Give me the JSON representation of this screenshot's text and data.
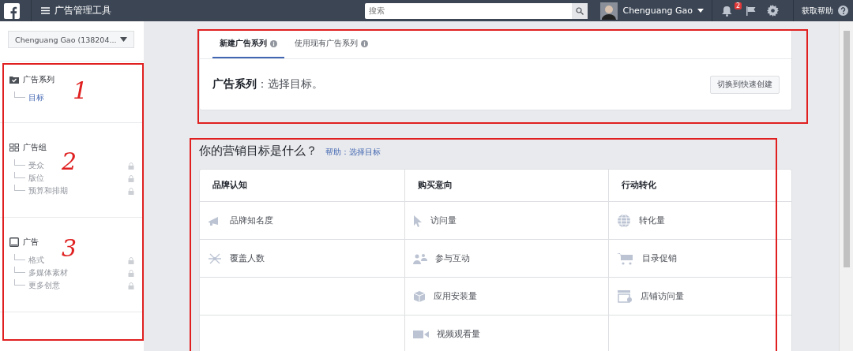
{
  "topbar": {
    "title": "广告管理工具",
    "search": {
      "placeholder": "搜索"
    },
    "user": "Chenguang Gao",
    "notifications": "2",
    "help": "获取帮助"
  },
  "sidebar": {
    "account": "Chenguang Gao (138204...",
    "sections": [
      {
        "title": "广告系列",
        "items": [
          {
            "label": "目标",
            "selected": true,
            "locked": false
          }
        ]
      },
      {
        "title": "广告组",
        "items": [
          {
            "label": "受众",
            "selected": false,
            "locked": true
          },
          {
            "label": "版位",
            "selected": false,
            "locked": true
          },
          {
            "label": "预算和排期",
            "selected": false,
            "locked": true
          }
        ]
      },
      {
        "title": "广告",
        "items": [
          {
            "label": "格式",
            "selected": false,
            "locked": true
          },
          {
            "label": "多媒体素材",
            "selected": false,
            "locked": true
          },
          {
            "label": "更多创意",
            "selected": false,
            "locked": true
          }
        ]
      }
    ]
  },
  "campaign_card": {
    "tabs": [
      {
        "label": "新建广告系列",
        "selected": true
      },
      {
        "label": "使用现有广告系列",
        "selected": false
      }
    ],
    "label": "广告系列",
    "value": "：选择目标。",
    "button": "切换到快速创建"
  },
  "objectives": {
    "title": "你的营销目标是什么？",
    "help_link": "帮助：选择目标",
    "columns": [
      {
        "heading": "品牌认知",
        "items": [
          "品牌知名度",
          "覆盖人数"
        ]
      },
      {
        "heading": "购买意向",
        "items": [
          "访问量",
          "参与互动",
          "应用安装量",
          "视频观看量"
        ]
      },
      {
        "heading": "行动转化",
        "items": [
          "转化量",
          "目录促销",
          "店铺访问量"
        ]
      }
    ]
  },
  "annotations": [
    {
      "label": "1"
    },
    {
      "label": "2"
    },
    {
      "label": "3"
    }
  ]
}
